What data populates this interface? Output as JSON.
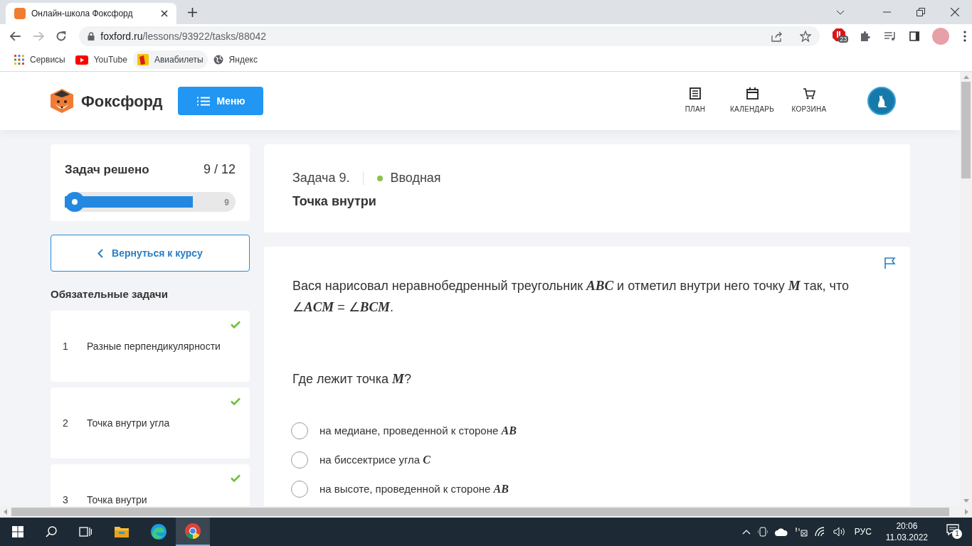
{
  "browser": {
    "tab_title": "Онлайн-школа Фоксфорд",
    "url_host": "foxford.ru",
    "url_path": "/lessons/93922/tasks/88042",
    "extension_badge": "23",
    "bookmarks": [
      {
        "label": "Сервисы",
        "kind": "apps"
      },
      {
        "label": "YouTube",
        "kind": "youtube"
      },
      {
        "label": "Авиабилеты",
        "kind": "tickets"
      },
      {
        "label": "Яндекс",
        "kind": "globe"
      }
    ]
  },
  "header": {
    "logo": "Фоксфорд",
    "menu_button": "Меню",
    "nav": [
      {
        "label": "ПЛАН",
        "kind": "plan"
      },
      {
        "label": "КАЛЕНДАРЬ",
        "kind": "calendar"
      },
      {
        "label": "КОРЗИНА",
        "kind": "cart"
      }
    ]
  },
  "progress": {
    "title": "Задач решено",
    "count": "9 / 12",
    "level": 0.75,
    "end_label": "9"
  },
  "back_button": "Вернуться к курсу",
  "tasks_heading": "Обязательные задачи",
  "tasks": [
    {
      "number": "1",
      "title": "Разные перпендикулярности",
      "checked": true
    },
    {
      "number": "2",
      "title": "Точка внутри угла",
      "checked": true
    },
    {
      "number": "3",
      "title": "Точка внутри",
      "checked": true
    }
  ],
  "task": {
    "label": "Задача 9.",
    "level_label": "Вводная",
    "color": "#8bc34a",
    "title": "Точка внутри"
  },
  "question": {
    "statement": "Вася нарисовал неравнобедренный треугольник *ABC* и отметил внутри него точку *M* так, что ∠*ACM* = ∠*BCM*.",
    "prompt": "Где лежит точка *M*?",
    "options": [
      {
        "text": "на медиане, проведенной к стороне *AB*",
        "selected": false
      },
      {
        "text": "на биссектрисе угла *C*",
        "selected": false
      },
      {
        "text": "на высоте, проведенной к стороне *AB*",
        "selected": false
      }
    ]
  },
  "taskbar": {
    "language": "РУС",
    "time": "20:06",
    "date": "11.03.2022",
    "notifications": "1"
  }
}
